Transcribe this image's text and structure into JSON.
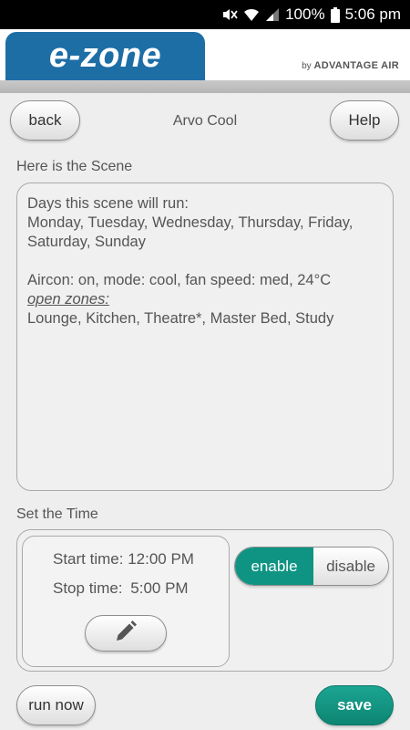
{
  "status_bar": {
    "battery_percent": "100%",
    "time": "5:06 pm"
  },
  "header": {
    "logo": "e-zone",
    "byline_prefix": "by",
    "byline_brand": "ADVANTAGE AIR"
  },
  "nav": {
    "back_label": "back",
    "title": "Arvo Cool",
    "help_label": "Help"
  },
  "scene": {
    "section_label": "Here is the Scene",
    "days_heading": "Days this scene will run:",
    "days_line1": "Monday, Tuesday, Wednesday, Thursday, Friday,",
    "days_line2": "Saturday, Sunday",
    "aircon": "Aircon: on, mode: cool, fan speed: med, 24°C",
    "zones_heading": "open zones:",
    "zones": "Lounge, Kitchen, Theatre*, Master Bed, Study"
  },
  "time": {
    "section_label": "Set the Time",
    "start_label": "Start time:",
    "start_value": "12:00 PM",
    "stop_label": "Stop time:",
    "stop_value": "5:00 PM",
    "enable_label": "enable",
    "disable_label": "disable",
    "selected": "enable"
  },
  "footer": {
    "run_now_label": "run now",
    "save_label": "save"
  },
  "colors": {
    "brand_blue": "#1e6ea6",
    "accent_teal": "#0f9483"
  },
  "icons": [
    "mute-icon",
    "wifi-icon",
    "signal-icon",
    "battery-icon",
    "pencil-icon"
  ]
}
